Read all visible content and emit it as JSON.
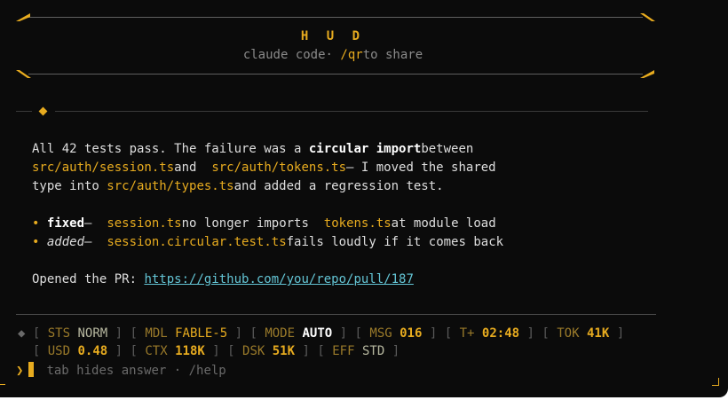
{
  "header": {
    "title": "H U D",
    "subtitle_prefix": "claude code·",
    "subtitle_cmd": "/qr",
    "subtitle_suffix": "to share"
  },
  "message": {
    "line1_a": "All 42 tests pass. The failure was a ",
    "line1_b": "circular import",
    "line1_c": "between",
    "line2_a": "src/auth/session.ts",
    "line2_b": "and ",
    "line2_c": "src/auth/tokens.ts",
    "line2_d": "— I moved the shared",
    "line3_a": "type into ",
    "line3_b": "src/auth/types.ts",
    "line3_c": "and added a regression test.",
    "bullets": [
      {
        "mark": "•",
        "tag": "fixed",
        "dash": "— ",
        "a": "session.ts",
        "b": "no longer imports ",
        "c": "tokens.ts",
        "d": "at module load"
      },
      {
        "mark": "•",
        "tag": "added",
        "dash": "— ",
        "a": "session.circular.test.ts",
        "b": "fails loudly if it comes back"
      }
    ],
    "pr_label": "Opened the PR: ",
    "pr_link": "https://github.com/you/repo/pull/187"
  },
  "status": {
    "row1": [
      {
        "label": "STS",
        "value": "NORM",
        "style": "n"
      },
      {
        "label": "MDL",
        "value": "FABLE-5",
        "style": "g"
      },
      {
        "label": "MODE",
        "value": "AUTO",
        "style": "w"
      },
      {
        "label": "MSG",
        "value": "016",
        "style": "g"
      },
      {
        "label": "T+",
        "value": "02:48",
        "style": "g"
      },
      {
        "label": "TOK",
        "value": "41K",
        "style": "g"
      }
    ],
    "row2": [
      {
        "label": "USD",
        "value": "0.48",
        "style": "g"
      },
      {
        "label": "CTX",
        "value": "118K",
        "style": "g"
      },
      {
        "label": "DSK",
        "value": "51K",
        "style": "g"
      },
      {
        "label": "EFF",
        "value": "STD",
        "style": "n"
      }
    ]
  },
  "prompt": {
    "chevron": "❯",
    "hint": "tab hides answer · /help"
  },
  "colors": {
    "accent": "#e7ab1f",
    "link": "#63c4d4",
    "background": "#0b0b0b"
  }
}
